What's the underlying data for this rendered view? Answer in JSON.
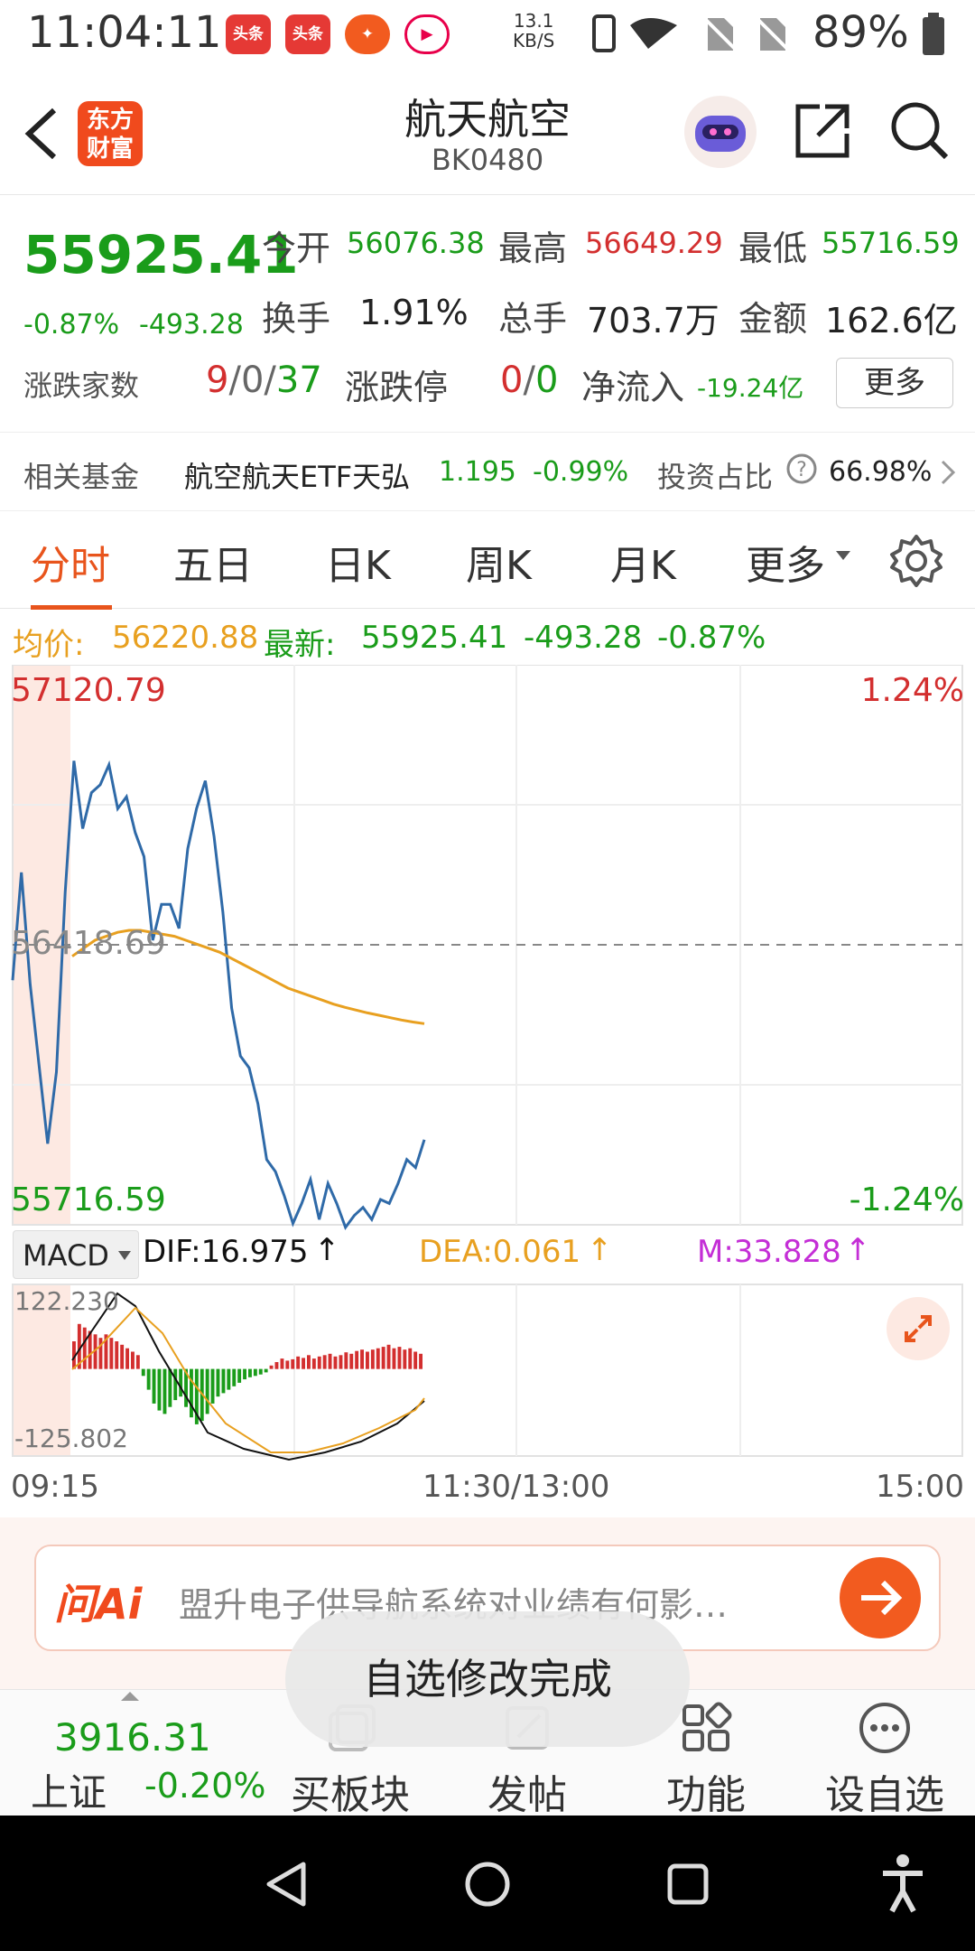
{
  "status_bar": {
    "time": "11:04:11",
    "app_badges": [
      "头条",
      "头条"
    ],
    "net_speed_value": "13.1",
    "net_speed_unit": "KB/S",
    "battery": "89%"
  },
  "header": {
    "logo_text_line1": "东方",
    "logo_text_line2": "财富",
    "title": "航天航空",
    "code": "BK0480"
  },
  "quote": {
    "price": "55925.41",
    "change_pct": "-0.87%",
    "change": "-493.28",
    "open_label": "今开",
    "open": "56076.38",
    "high_label": "最高",
    "high": "56649.29",
    "low_label": "最低",
    "low": "55716.59",
    "turnover_label": "换手",
    "turnover": "1.91%",
    "volume_label": "总手",
    "volume": "703.7万",
    "amount_label": "金额",
    "amount": "162.6亿",
    "adv_label": "涨跌家数",
    "adv_up": "9",
    "adv_flat": "0",
    "adv_down": "37",
    "limit_label": "涨跌停",
    "limit_up": "0",
    "limit_down": "0",
    "netflow_label": "净流入",
    "netflow": "-19.24亿",
    "more_button": "更多"
  },
  "fund": {
    "label": "相关基金",
    "name": "航空航天ETF天弘",
    "price": "1.195",
    "change": "-0.99%",
    "ratio_label": "投资占比",
    "ratio": "66.98%"
  },
  "tabs": [
    "分时",
    "五日",
    "日K",
    "周K",
    "月K",
    "更多"
  ],
  "avg_row": {
    "avg_label": "均价:",
    "avg_value": "56220.88",
    "latest_label": "最新:",
    "latest_value": "55925.41",
    "change": "-493.28",
    "change_pct": "-0.87%"
  },
  "chart_labels": {
    "max": "57120.79",
    "mid": "56418.69",
    "min": "55716.59",
    "pct_up": "1.24%",
    "pct_down": "-1.24%",
    "macd_select": "MACD",
    "dif": "DIF:16.975",
    "dea": "DEA:0.061",
    "m": "M:33.828",
    "macd_max": "122.230",
    "macd_min": "-125.802",
    "time_start": "09:15",
    "time_mid": "11:30/13:00",
    "time_end": "15:00"
  },
  "chart_data": {
    "type": "line",
    "price_axis": {
      "ylim": [
        55716.59,
        57120.79
      ],
      "prev_close": 56418.69
    },
    "series": [
      {
        "name": "price",
        "color": "#2f6aa8",
        "values": [
          56330,
          56600,
          56320,
          56120,
          55920,
          56100,
          56550,
          56880,
          56710,
          56800,
          56820,
          56870,
          56760,
          56790,
          56700,
          56640,
          56430,
          56520,
          56520,
          56460,
          56660,
          56760,
          56830,
          56690,
          56500,
          56260,
          56140,
          56110,
          56020,
          55880,
          55850,
          55790,
          55720,
          55770,
          55830,
          55730,
          55820,
          55770,
          55710,
          55740,
          55760,
          55730,
          55780,
          55770,
          55820,
          55880,
          55860,
          55930
        ]
      },
      {
        "name": "avg",
        "color": "#e8a020",
        "values": [
          56390,
          56410,
          56430,
          56440,
          56450,
          56455,
          56455,
          56450,
          56445,
          56440,
          56430,
          56420,
          56410,
          56400,
          56385,
          56370,
          56355,
          56340,
          56325,
          56310,
          56300,
          56290,
          56280,
          56270,
          56262,
          56255,
          56248,
          56242,
          56236,
          56230,
          56225,
          56221
        ]
      }
    ],
    "macd_axis": {
      "ylim": [
        -125.802,
        122.23
      ]
    },
    "macd_hist": [
      40,
      65,
      60,
      55,
      50,
      45,
      50,
      45,
      40,
      35,
      30,
      25,
      20,
      -10,
      -30,
      -50,
      -60,
      -65,
      -55,
      -45,
      -40,
      -55,
      -70,
      -80,
      -75,
      -65,
      -50,
      -40,
      -35,
      -30,
      -25,
      -20,
      -15,
      -12,
      -10,
      -8,
      -5,
      5,
      10,
      15,
      12,
      14,
      18,
      16,
      20,
      15,
      18,
      20,
      22,
      18,
      20,
      24,
      22,
      26,
      28,
      25,
      28,
      30,
      32,
      35,
      30,
      32,
      28,
      30,
      25,
      22
    ]
  },
  "ask_ai": {
    "brand": "问Ai",
    "placeholder": "盟升电子供导航系统对业绩有何影…"
  },
  "toast": "自选修改完成",
  "bottom_bar": {
    "index_value": "3916.31",
    "index_name": "上证",
    "index_change": "-0.20%",
    "items": [
      "买板块",
      "发帖",
      "功能",
      "设自选"
    ]
  }
}
